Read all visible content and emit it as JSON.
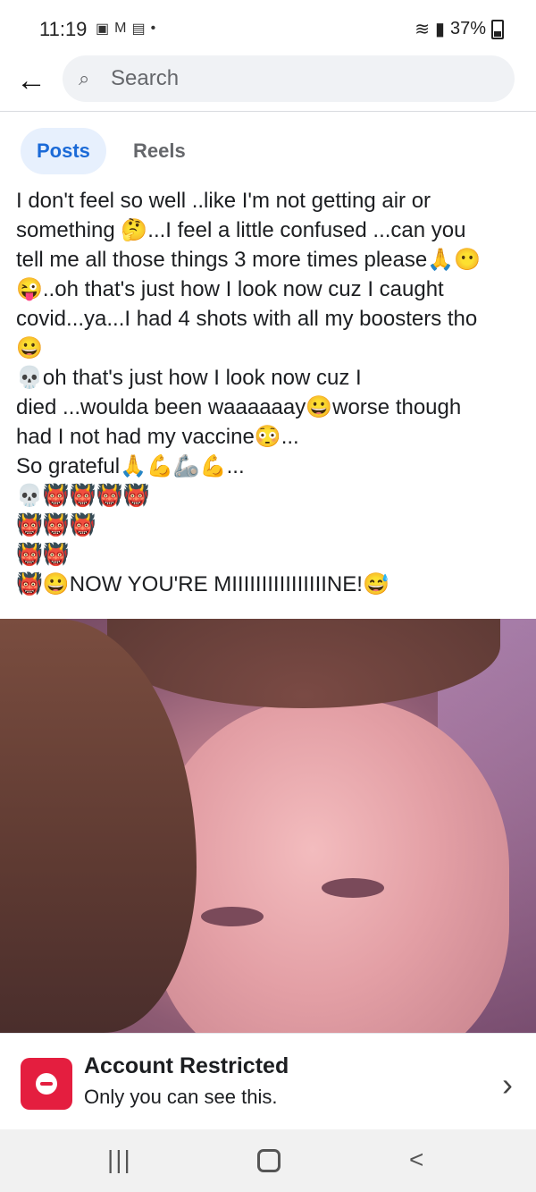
{
  "status_bar": {
    "time": "11:19",
    "notification_icons": [
      "image-icon",
      "gmail-icon",
      "messages-icon",
      "dot"
    ],
    "battery": "37%"
  },
  "header": {
    "search_placeholder": "Search"
  },
  "tabs": [
    {
      "label": "Posts",
      "active": true
    },
    {
      "label": "Reels",
      "active": false
    }
  ],
  "post": {
    "lines": [
      "I don't feel so well ..like I'm  not getting air or",
      "something 🤔...I feel a little confused ...can you",
      "tell me all those things 3 more times please🙏😶",
      "😜..oh that's just how I look now cuz I caught",
      "covid...ya...I had 4 shots with all my boosters tho",
      "😀",
      "💀oh that's just how I look now cuz I",
      "died ...woulda been waaaaaay😀worse though",
      "had I not had my vaccine😳...",
      "So grateful🙏💪🦾💪...",
      "💀👹👹👹👹",
      "👹👹👹",
      "👹👹",
      "👹😀NOW YOU'RE MIIIIIIIIIIIIIIIINE!😅"
    ]
  },
  "banner": {
    "title": "Account Restricted",
    "subtitle": "Only you can see this."
  },
  "navbar": {
    "recent_label": "|||",
    "back_label": "<"
  },
  "colors": {
    "accent": "#1b6ad7",
    "tab_active_bg": "#e7f0fd",
    "restricted_red": "#e41e3f"
  }
}
